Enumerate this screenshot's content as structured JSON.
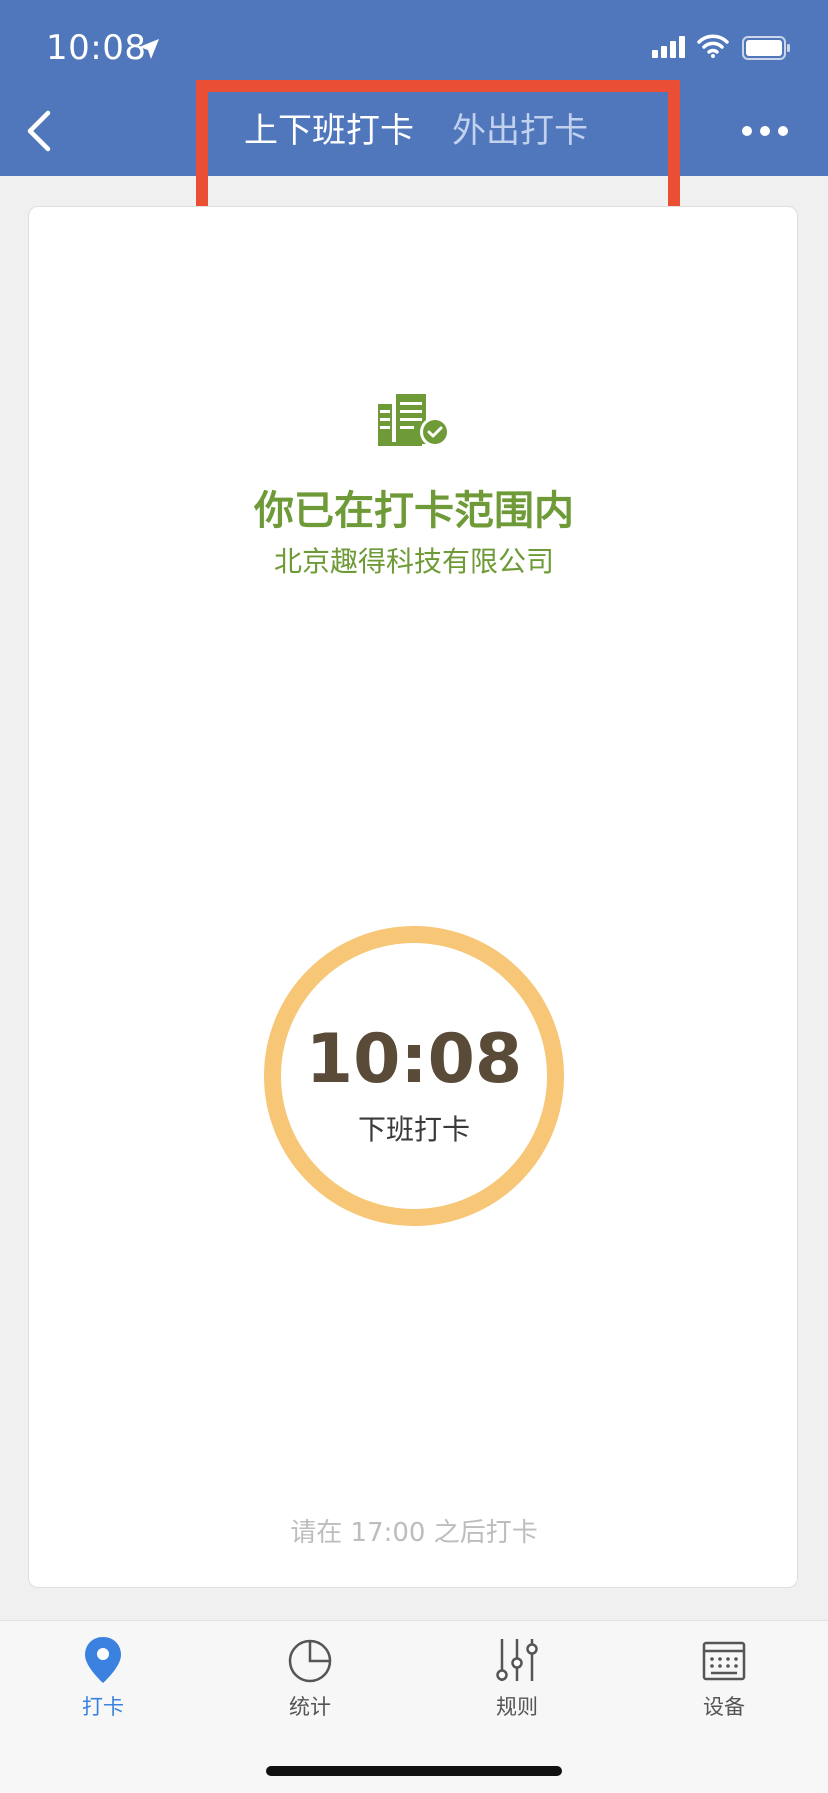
{
  "status_bar": {
    "time": "10:08"
  },
  "nav": {
    "tabs": [
      {
        "label": "上下班打卡"
      },
      {
        "label": "外出打卡"
      }
    ]
  },
  "location": {
    "title": "你已在打卡范围内",
    "company": "北京趣得科技有限公司"
  },
  "clock": {
    "time": "10:08",
    "label": "下班打卡"
  },
  "hint": "请在 17:00 之后打卡",
  "tabbar": {
    "items": [
      {
        "label": "打卡",
        "icon": "location-pin-icon"
      },
      {
        "label": "统计",
        "icon": "pie-chart-icon"
      },
      {
        "label": "规则",
        "icon": "sliders-icon"
      },
      {
        "label": "设备",
        "icon": "device-icon"
      }
    ]
  },
  "colors": {
    "header": "#5077bb",
    "green": "#6e9b37",
    "ring": "#f7c676",
    "active_tab": "#3b82e0",
    "highlight": "#ea4e35"
  }
}
